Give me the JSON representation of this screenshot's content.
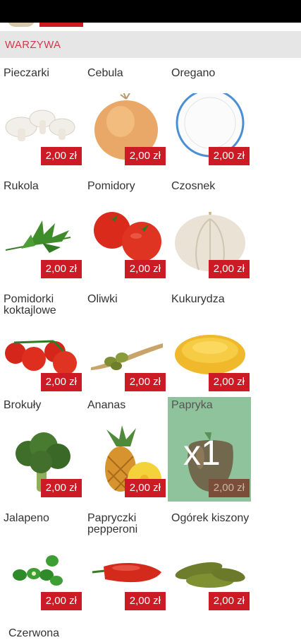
{
  "section": {
    "title": "WARZYWA"
  },
  "products": [
    {
      "name": "Pieczarki",
      "price": "2,00 zł",
      "icon": "mushrooms-image"
    },
    {
      "name": "Cebula",
      "price": "2,00 zł",
      "icon": "onion-image"
    },
    {
      "name": "Oregano",
      "price": "2,00 zł",
      "icon": "empty-plate-image"
    },
    {
      "name": "Rukola",
      "price": "2,00 zł",
      "icon": "arugula-image"
    },
    {
      "name": "Pomidory",
      "price": "2,00 zł",
      "icon": "tomatoes-image"
    },
    {
      "name": "Czosnek",
      "price": "2,00 zł",
      "icon": "garlic-image"
    },
    {
      "name": "Pomidorki koktajlowe",
      "price": "2,00 zł",
      "icon": "cherry-tomatoes-image"
    },
    {
      "name": "Oliwki",
      "price": "2,00 zł",
      "icon": "olives-image"
    },
    {
      "name": "Kukurydza",
      "price": "2,00 zł",
      "icon": "corn-image"
    },
    {
      "name": "Brokuły",
      "price": "2,00 zł",
      "icon": "broccoli-image"
    },
    {
      "name": "Ananas",
      "price": "2,00 zł",
      "icon": "pineapple-image"
    },
    {
      "name": "Papryka",
      "price": "2,00 zł",
      "icon": "pepper-image",
      "selected_qty": "x1"
    },
    {
      "name": "Jalapeno",
      "price": "2,00 zł",
      "icon": "jalapeno-image"
    },
    {
      "name": "Papryczki pepperoni",
      "price": "2,00 zł",
      "icon": "pepperoni-pepper-image"
    },
    {
      "name": "Ogórek kiszony",
      "price": "2,00 zł",
      "icon": "pickles-image"
    }
  ],
  "next_item": {
    "name": "Czerwona"
  },
  "colors": {
    "price_tag": "#cc1b24",
    "section_title": "#d23a4a",
    "selected_tile": "#8fc39b"
  }
}
